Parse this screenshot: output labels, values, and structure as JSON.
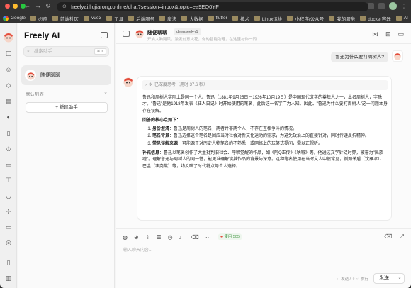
{
  "browser": {
    "url": "freelyai.liujiarong.online/chat?session=inbox&topic=ea9EQ0YF",
    "bookmarks": [
      "Google",
      "必应",
      "前端社区",
      "vue3",
      "工具",
      "后端服务",
      "魔法",
      "大数据",
      "flutter",
      "技术",
      "Linux运维",
      "小程序/公众号",
      "我的服务",
      "docker容器",
      "AI"
    ]
  },
  "sidebar": {
    "brand": "Freely AI",
    "search_placeholder": "搜索助手...",
    "search_shortcut": "⌘ K",
    "active_agent": "随便聊聊",
    "default_list_label": "默认列表",
    "new_assistant_label": "+ 新建助手"
  },
  "header": {
    "title": "随便聊聊",
    "model": "deepseek-r1",
    "subtitle": "开启大脑飓风，激发创意火花，你的智能助理，在这里与你一同…"
  },
  "conversation": {
    "user_message": "鲁迅为什么要打周树人?",
    "thinking_label": "已深度思考（用时 37.6 秒）",
    "answer_intro": "鲁迅和周树人实际上是同一个人。鲁迅（1881年9月25日－1936年10月19日）是中国现代文学的奠基人之一，本名周树人，字豫才。\"鲁迅\"是他1918年发表《狂人日记》时开始使用的笔名，此后这一名字广为人知。因此，\"鲁迅为什么要打周树人\"这一问题本身存在误解。",
    "answer_heading": "回答的核心点如下：",
    "points": [
      {
        "label": "身份澄清",
        "text": "：鲁迅是周树人的笔名，两者并非两个人，不存在互相争斗的情况。"
      },
      {
        "label": "笔名背景",
        "text": "：鲁迅选择这个笔名是因应当时社会对新文化运动的需求，为避免政治上的直接针对，同时传递反抗精神。"
      },
      {
        "label": "常见误解来源",
        "text": "：可能源于对历史人物笔名的不熟悉，或网络上的玩笑式提问，需以正视听。"
      }
    ],
    "supplement_label": "补充信息",
    "supplement_text": "：鲁迅以笔名创作了大量批判旧社会、呼唤觉醒的作品，如《阿Q正传》《呐喊》等。他通过文学针砭时弊，被誉为\"民族魂\"。理解鲁迅与周树人的同一性，能更准确解读其作品的背景与深意。这种笔名使用在当时文人中很常见，例如茅盾（沈雁冰）、巴金（李尧棠）等，均反映了时代特点与个人选择。"
  },
  "composer": {
    "tokens_label": "使用 505",
    "placeholder": "输入聊天内容...",
    "hint": "↵ 发送 / ⇧ ↵ 换行",
    "send_label": "发送"
  },
  "colors": {
    "accent_red": "#e34c3c",
    "tokens_green": "#4a9a4a"
  }
}
